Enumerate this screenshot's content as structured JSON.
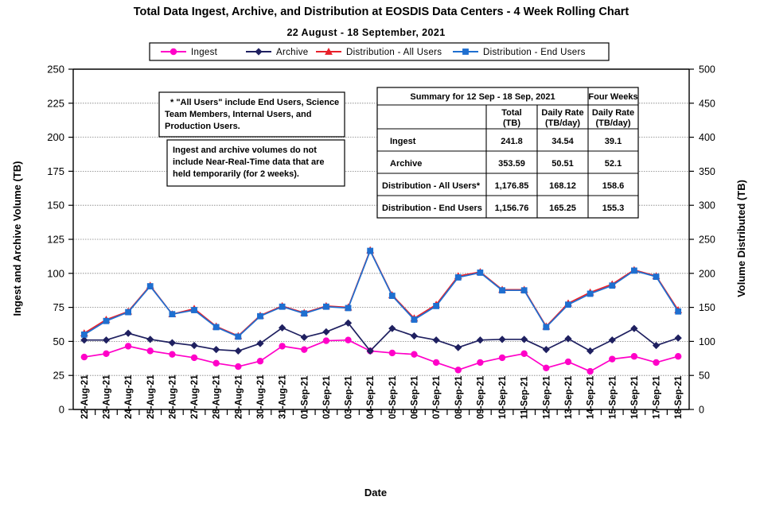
{
  "chart_data": {
    "type": "line",
    "title": "Total Data Ingest, Archive, and  Distribution at EOSDIS Data Centers - 4 Week Rolling Chart",
    "subtitle": "22 August  -  18 September,  2021",
    "xlabel": "Date",
    "ylabel": "Ingest and Archive Volume (TB)",
    "y2label": "Volume Distributed (TB)",
    "ylim": [
      0,
      250
    ],
    "y2lim": [
      0,
      500
    ],
    "yticks": [
      0,
      25,
      50,
      75,
      100,
      125,
      150,
      175,
      200,
      225,
      250
    ],
    "y2ticks": [
      0,
      50,
      100,
      150,
      200,
      250,
      300,
      350,
      400,
      450,
      500
    ],
    "grid": true,
    "legend_position": "top",
    "categories": [
      "22-Aug-21",
      "23-Aug-21",
      "24-Aug-21",
      "25-Aug-21",
      "26-Aug-21",
      "27-Aug-21",
      "28-Aug-21",
      "29-Aug-21",
      "30-Aug-21",
      "31-Aug-21",
      "01-Sep-21",
      "02-Sep-21",
      "03-Sep-21",
      "04-Sep-21",
      "05-Sep-21",
      "06-Sep-21",
      "07-Sep-21",
      "08-Sep-21",
      "09-Sep-21",
      "10-Sep-21",
      "11-Sep-21",
      "12-Sep-21",
      "13-Sep-21",
      "14-Sep-21",
      "15-Sep-21",
      "16-Sep-21",
      "17-Sep-21",
      "18-Sep-21"
    ],
    "series": [
      {
        "name": "Ingest",
        "axis": "left",
        "color": "#FF00C8",
        "marker": "circle",
        "values": [
          38.5,
          41.0,
          46.5,
          43.0,
          40.5,
          38.0,
          34.0,
          31.5,
          35.5,
          46.5,
          44.0,
          50.5,
          51.0,
          43.0,
          41.5,
          40.5,
          34.5,
          29.0,
          34.5,
          38.0,
          41.0,
          30.5,
          35.0,
          28.0,
          37.0,
          39.0,
          34.5,
          39.0
        ]
      },
      {
        "name": "Archive",
        "axis": "left",
        "color": "#1F2060",
        "marker": "diamond",
        "values": [
          51.0,
          51.0,
          56.0,
          51.5,
          49.0,
          47.0,
          44.0,
          43.0,
          48.5,
          60.0,
          53.0,
          57.0,
          63.5,
          43.0,
          59.5,
          54.0,
          51.0,
          45.5,
          51.0,
          51.5,
          51.5,
          44.0,
          52.0,
          43.0,
          51.0,
          59.5,
          47.0,
          52.5
        ]
      },
      {
        "name": "Distribution - All Users",
        "axis": "right",
        "color": "#E8202A",
        "marker": "triangle",
        "values": [
          112,
          132,
          144,
          182,
          140,
          148,
          122,
          108,
          138,
          152,
          142,
          152,
          150,
          234,
          168,
          134,
          154,
          196,
          202,
          176,
          176,
          122,
          156,
          172,
          184,
          205,
          196,
          146
        ]
      },
      {
        "name": "Distribution - End Users",
        "axis": "right",
        "color": "#1F6FD0",
        "marker": "square",
        "values": [
          110,
          130,
          143,
          181,
          140,
          146,
          121,
          107,
          137,
          151,
          141,
          151,
          149,
          233,
          167,
          132,
          152,
          194,
          201,
          175,
          175,
          121,
          154,
          170,
          182,
          204,
          195,
          144
        ]
      }
    ],
    "annotations": [
      {
        "id": "all-users-note",
        "lines": [
          "* \"All Users\" include End Users, Science",
          "Team Members,  Internal Users, and",
          "Production Users."
        ]
      },
      {
        "id": "nrt-note",
        "lines": [
          "Ingest and archive volumes do not",
          "include Near-Real-Time data that are",
          "held temporarily (for 2 weeks)."
        ]
      }
    ],
    "summary_table": {
      "title": "Summary for  12 Sep  -  18 Sep,  2021",
      "group_header": "Four Weeks",
      "columns": [
        {
          "line1": "Total",
          "line2": "(TB)"
        },
        {
          "line1": "Daily Rate",
          "line2": "(TB/day)"
        },
        {
          "line1": "Daily Rate",
          "line2": "(TB/day)"
        }
      ],
      "rows": [
        {
          "label": "Ingest",
          "total": "241.8",
          "daily_rate": "34.54",
          "four_week_daily_rate": "39.1"
        },
        {
          "label": "Archive",
          "total": "353.59",
          "daily_rate": "50.51",
          "four_week_daily_rate": "52.1"
        },
        {
          "label": "Distribution - All Users*",
          "total": "1,176.85",
          "daily_rate": "168.12",
          "four_week_daily_rate": "158.6"
        },
        {
          "label": "Distribution - End Users",
          "total": "1,156.76",
          "daily_rate": "165.25",
          "four_week_daily_rate": "155.3"
        }
      ]
    }
  }
}
